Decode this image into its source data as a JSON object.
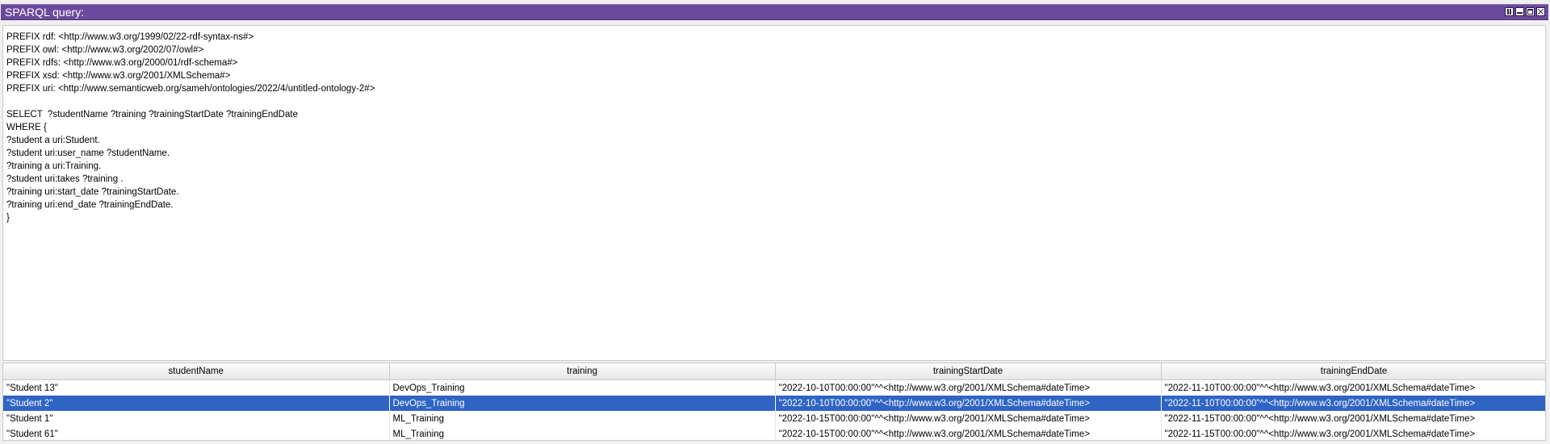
{
  "window": {
    "title": "SPARQL query:",
    "controls": [
      "tile-icon",
      "minimize-icon",
      "maximize-icon",
      "close-icon"
    ]
  },
  "editor": {
    "query": "PREFIX rdf: <http://www.w3.org/1999/02/22-rdf-syntax-ns#>\nPREFIX owl: <http://www.w3.org/2002/07/owl#>\nPREFIX rdfs: <http://www.w3.org/2000/01/rdf-schema#>\nPREFIX xsd: <http://www.w3.org/2001/XMLSchema#>\nPREFIX uri: <http://www.semanticweb.org/sameh/ontologies/2022/4/untitled-ontology-2#>\n\nSELECT  ?studentName ?training ?trainingStartDate ?trainingEndDate\nWHERE {\n?student a uri:Student.\n?student uri:user_name ?studentName.\n?training a uri:Training.\n?student uri:takes ?training .\n?training uri:start_date ?trainingStartDate.\n?training uri:end_date ?trainingEndDate.\n}"
  },
  "results": {
    "columns": [
      "studentName",
      "training",
      "trainingStartDate",
      "trainingEndDate"
    ],
    "rows": [
      [
        "\"Student 13\"",
        "DevOps_Training",
        "\"2022-10-10T00:00:00\"^^<http://www.w3.org/2001/XMLSchema#dateTime>",
        "\"2022-11-10T00:00:00\"^^<http://www.w3.org/2001/XMLSchema#dateTime>"
      ],
      [
        "\"Student 2\"",
        "DevOps_Training",
        "\"2022-10-10T00:00:00\"^^<http://www.w3.org/2001/XMLSchema#dateTime>",
        "\"2022-11-10T00:00:00\"^^<http://www.w3.org/2001/XMLSchema#dateTime>"
      ],
      [
        "\"Student 1\"",
        "ML_Training",
        "\"2022-10-15T00:00:00\"^^<http://www.w3.org/2001/XMLSchema#dateTime>",
        "\"2022-11-15T00:00:00\"^^<http://www.w3.org/2001/XMLSchema#dateTime>"
      ],
      [
        "\"Student 61\"",
        "ML_Training",
        "\"2022-10-15T00:00:00\"^^<http://www.w3.org/2001/XMLSchema#dateTime>",
        "\"2022-11-15T00:00:00\"^^<http://www.w3.org/2001/XMLSchema#dateTime>"
      ]
    ],
    "selected_row": 1
  },
  "colors": {
    "titlebar": "#6b4a9e",
    "selection": "#2f64c4"
  }
}
